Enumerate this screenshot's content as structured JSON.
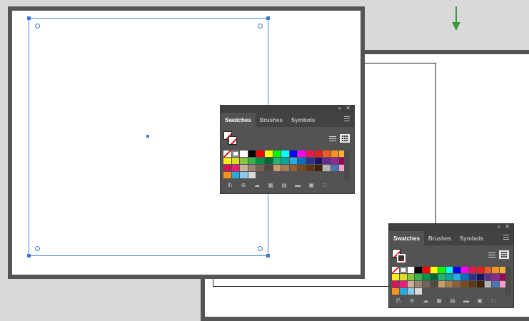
{
  "panel": {
    "tabs": [
      "Swatches",
      "Brushes",
      "Symbols"
    ],
    "collapse_glyph": "«",
    "close_glyph": "✕",
    "bottom_icons": [
      "swatch-libraries-icon",
      "show-kinds-icon",
      "cloud-icon",
      "color-group-icon",
      "swatch-options-icon",
      "new-folder-icon",
      "new-swatch-icon",
      "delete-icon"
    ],
    "bottom_glyphs": [
      "Ⅱ\\",
      "⊕",
      "☁",
      "▦",
      "▤",
      "▬",
      "▣",
      "□"
    ]
  },
  "swatch_colors": [
    "none",
    "reg",
    "#ffffff",
    "#000000",
    "#ff0000",
    "#ffff00",
    "#00ff00",
    "#00ffff",
    "#0000ff",
    "#ff00ff",
    "#e6194b",
    "#e6201f",
    "#f15a24",
    "#f7931e",
    "#fbb03b",
    "#fcee21",
    "#d9e021",
    "#8cc63f",
    "#39b54a",
    "#009245",
    "#006837",
    "#22b573",
    "#00a99d",
    "#29abe2",
    "#0071bc",
    "#2e3192",
    "#1b1464",
    "#662d91",
    "#93278f",
    "#9e005d",
    "#d4145a",
    "#ed1e79",
    "#c7b299",
    "#998675",
    "#736357",
    "#534741",
    "#c69c6d",
    "#a67c52",
    "#8c6239",
    "#754c24",
    "#603813",
    "#42210b",
    "#b3b3b3",
    "#4d73b9",
    "#f2a0c8",
    "#f7931e",
    "#29abe2",
    "#8cc8e8",
    "#d9d9d9"
  ],
  "arrow_color": "#3a9a3a"
}
